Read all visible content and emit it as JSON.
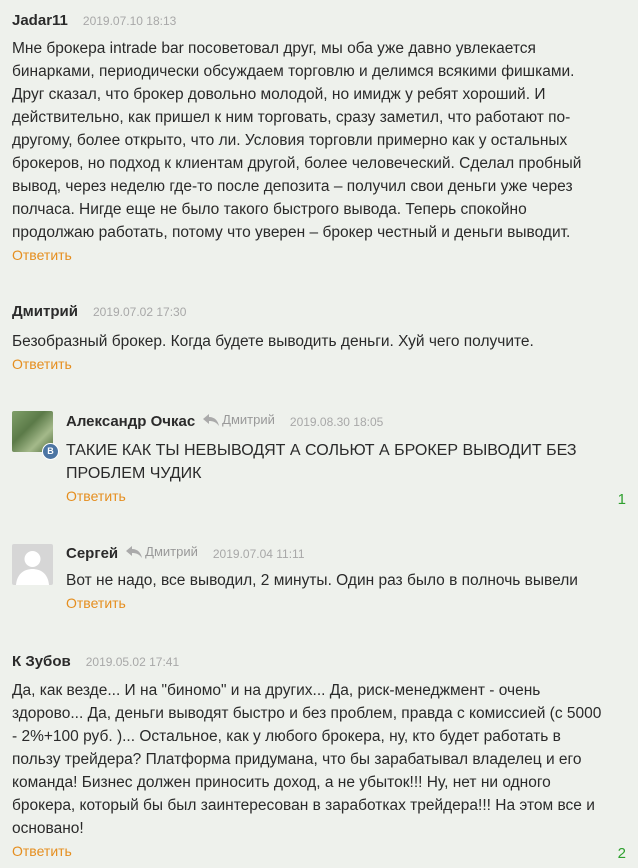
{
  "reply_label": "Ответить",
  "comments": [
    {
      "author": "Jadar11",
      "date": "2019.07.10 18:13",
      "lines": [
        "Мне брокера intrade bar посоветовал друг, мы оба уже давно увлекается",
        "бинарками, периодически обсуждаем торговлю и делимся всякими фишками.",
        "Друг сказал, что брокер довольно молодой, но имидж у ребят хороший. И",
        "действительно, как пришел к ним торговать, сразу заметил, что работают по-",
        "другому, более открыто, что ли. Условия торговли примерно как у остальных",
        "брокеров, но подход к клиентам другой, более человеческий. Сделал пробный",
        "вывод, через неделю где-то после депозита – получил свои деньги уже через",
        "полчаса. Нигде еще не было такого быстрого вывода. Теперь спокойно",
        "продолжаю работать, потому что уверен – брокер честный и деньги выводит."
      ]
    },
    {
      "author": "Дмитрий",
      "date": "2019.07.02 17:30",
      "lines": [
        "Безобразный брокер. Когда будете выводить деньги. Хуй чего получите."
      ]
    },
    {
      "author": "Александр Очкас",
      "reply_to": "Дмитрий",
      "date": "2019.08.30 18:05",
      "badge": "В",
      "lines": [
        "ТАКИЕ КАК ТЫ НЕВЫВОДЯТ А СОЛЬЮТ А БРОКЕР ВЫВОДИТ БЕЗ",
        "ПРОБЛЕМ ЧУДИК"
      ],
      "likes": "1"
    },
    {
      "author": "Сергей",
      "reply_to": "Дмитрий",
      "date": "2019.07.04 11:11",
      "lines": [
        "Вот не надо, все выводил, 2 минуты. Один раз было в полночь вывели"
      ]
    },
    {
      "author": "К Зубов",
      "date": "2019.05.02 17:41",
      "lines": [
        "Да, как везде... И на \"биномо\" и на других... Да, риск-менеджмент - очень",
        "здорово... Да, деньги выводят быстро и без проблем, правда с комиссией (с 5000",
        "- 2%+100 руб. )... Остальное, как у любого брокера, ну, кто будет работать в",
        "пользу трейдера? Платформа придумана, что бы зарабатывал владелец и его",
        "команда! Бизнес должен приносить доход, а не убыток!!! Ну, нет ни одного",
        "брокера, который бы был заинтересован в заработках трейдера!!! На этом все и",
        "основано!"
      ],
      "likes": "2"
    }
  ]
}
